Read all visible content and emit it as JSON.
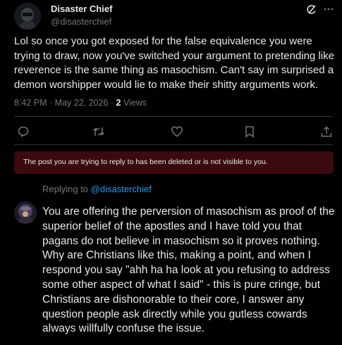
{
  "tweet": {
    "author_name": "Disaster Chief",
    "author_handle": "@disasterchief",
    "text": "Lol so once you got exposed for the false equivalence you were trying to draw, now you've switched your argument to pretending like reverence is the same thing as masochism. Can't say im surprised a demon worshipper would lie to make their shitty arguments work.",
    "timestamp": "8:42 PM · May 22, 2026 · ",
    "views_count": "2",
    "views_label": " Views",
    "icons": [
      "grok-icon",
      "more-icon",
      "reply-icon",
      "retweet-icon",
      "like-icon",
      "views-icon",
      "bookmark-icon",
      "share-icon"
    ]
  },
  "notice": {
    "text": "The post you are trying to reply to has been deleted or is not visible to you."
  },
  "reply": {
    "replying_prefix": "Replying to ",
    "replying_handle": "@disasterchief",
    "paragraph1": "You are offering the perversion of masochism as proof of the superior belief of the apostles and I have told you that pagans do not believe in masochism so it proves nothing.",
    "paragraph2": "Why are Christians like this, making a point, and when I respond you say \"ahh ha ha look at you refusing to address some other aspect of what I said\" - this is pure cringe, but Christians are dishonorable to their core, I answer any question people ask directly while you gutless cowards always willfully confuse the issue."
  },
  "colors": {
    "background": "#000000",
    "text": "#e7e9ea",
    "secondary": "#71767b",
    "link": "#1d9bf0",
    "notice_bg": "#3a0a10"
  }
}
